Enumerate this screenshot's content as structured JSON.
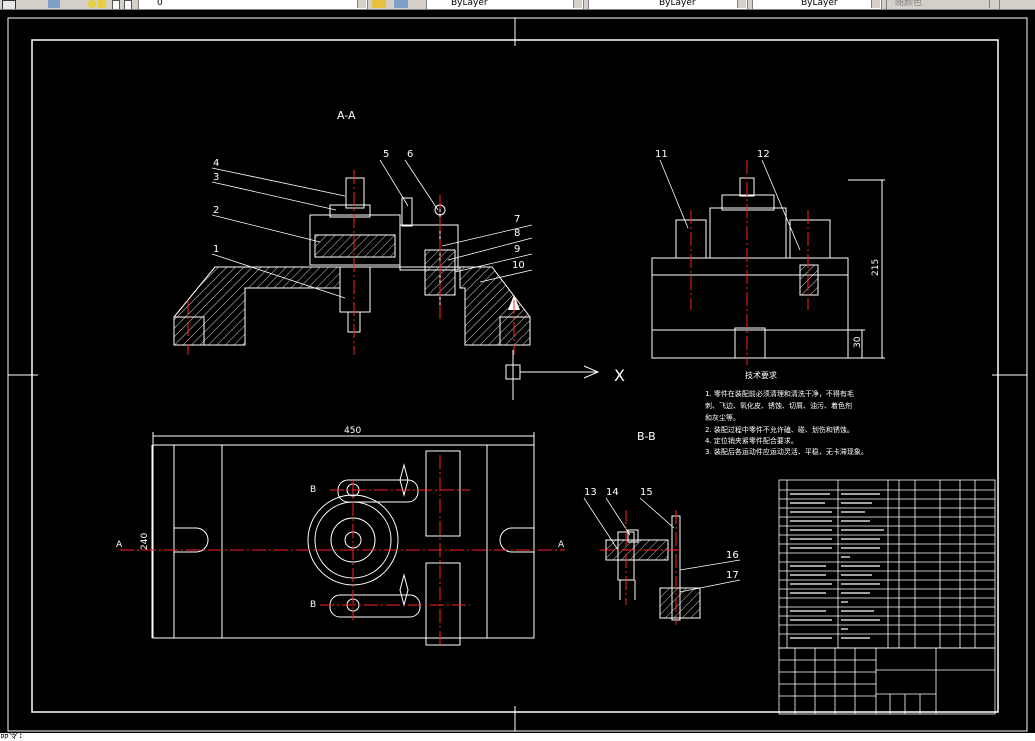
{
  "toolbar": {
    "layer_value": "0",
    "color_value": "ByLayer",
    "linetype_value": "ByLayer",
    "lineweight_value": "ByLayer",
    "plotstyle_value": "随颜色"
  },
  "drawing": {
    "section_aa": "A-A",
    "section_bb": "B-B",
    "axis_x": "X",
    "callouts": {
      "c1": "1",
      "c2": "2",
      "c3": "3",
      "c4": "4",
      "c5": "5",
      "c6": "6",
      "c7": "7",
      "c8": "8",
      "c9": "9",
      "c10": "10",
      "c11": "11",
      "c12": "12",
      "c13": "13",
      "c14": "14",
      "c15": "15",
      "c16": "16",
      "c17": "17"
    },
    "dims": {
      "width_450": "450",
      "height_240": "240",
      "height_215": "215",
      "base_30": "30"
    },
    "section_markers": {
      "a_left": "A",
      "a_right": "A",
      "b_top": "B",
      "b_bottom": "B"
    },
    "tech_req_title": "技术要求",
    "tech_requirements": [
      "1. 零件在装配前必须清理和清洗干净，不得有毛",
      "刺、飞边、氧化皮、锈蚀、切屑、油污、着色剂",
      "和灰尘等。",
      "2. 装配过程中零件不允许磕、碰、划伤和锈蚀。",
      "4. 定位销夹紧零件配合要求。",
      "3. 装配后各运动件应运动灵活、平稳，无卡滞现象。"
    ]
  },
  "command_line": {
    "text": "命令:"
  },
  "colors": {
    "background": "#000000",
    "line_white": "#ffffff",
    "center_red": "#ff2020",
    "hatch": "#ffffff",
    "toolbar_bg": "#d4d0c8"
  }
}
